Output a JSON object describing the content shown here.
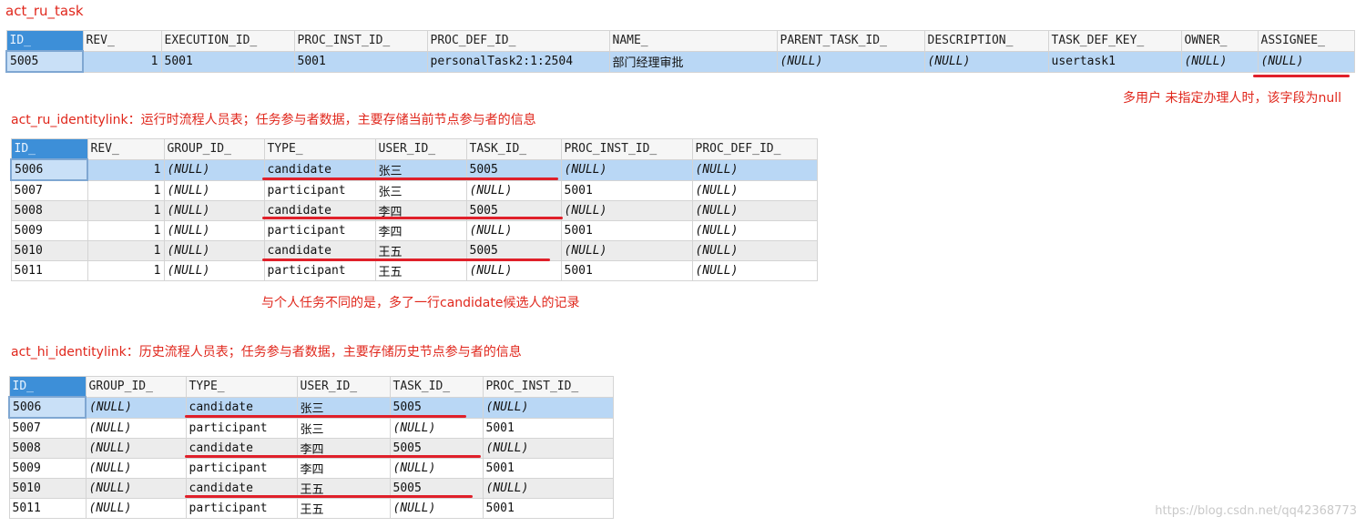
{
  "section1": {
    "title": "act_ru_task",
    "columns": [
      "ID_",
      "REV_",
      "EXECUTION_ID_",
      "PROC_INST_ID_",
      "PROC_DEF_ID_",
      "NAME_",
      "PARENT_TASK_ID_",
      "DESCRIPTION_",
      "TASK_DEF_KEY_",
      "OWNER_",
      "ASSIGNEE_"
    ],
    "rows": [
      [
        "5005",
        "1",
        "5001",
        "5001",
        "personalTask2:1:2504",
        "部门经理审批",
        "(NULL)",
        "(NULL)",
        "usertask1",
        "(NULL)",
        "(NULL)"
      ]
    ],
    "note": "多用户 未指定办理人时，该字段为null"
  },
  "section2": {
    "title": "act_ru_identitylink：运行时流程人员表；任务参与者数据，主要存储当前节点参与者的信息",
    "columns": [
      "ID_",
      "REV_",
      "GROUP_ID_",
      "TYPE_",
      "USER_ID_",
      "TASK_ID_",
      "PROC_INST_ID_",
      "PROC_DEF_ID_"
    ],
    "rows": [
      [
        "5006",
        "1",
        "(NULL)",
        "candidate",
        "张三",
        "5005",
        "(NULL)",
        "(NULL)"
      ],
      [
        "5007",
        "1",
        "(NULL)",
        "participant",
        "张三",
        "(NULL)",
        "5001",
        "(NULL)"
      ],
      [
        "5008",
        "1",
        "(NULL)",
        "candidate",
        "李四",
        "5005",
        "(NULL)",
        "(NULL)"
      ],
      [
        "5009",
        "1",
        "(NULL)",
        "participant",
        "李四",
        "(NULL)",
        "5001",
        "(NULL)"
      ],
      [
        "5010",
        "1",
        "(NULL)",
        "candidate",
        "王五",
        "5005",
        "(NULL)",
        "(NULL)"
      ],
      [
        "5011",
        "1",
        "(NULL)",
        "participant",
        "王五",
        "(NULL)",
        "5001",
        "(NULL)"
      ]
    ],
    "note": "与个人任务不同的是，多了一行candidate候选人的记录"
  },
  "section3": {
    "title": "act_hi_identitylink：历史流程人员表；任务参与者数据，主要存储历史节点参与者的信息",
    "columns": [
      "ID_",
      "GROUP_ID_",
      "TYPE_",
      "USER_ID_",
      "TASK_ID_",
      "PROC_INST_ID_"
    ],
    "rows": [
      [
        "5006",
        "(NULL)",
        "candidate",
        "张三",
        "5005",
        "(NULL)"
      ],
      [
        "5007",
        "(NULL)",
        "participant",
        "张三",
        "(NULL)",
        "5001"
      ],
      [
        "5008",
        "(NULL)",
        "candidate",
        "李四",
        "5005",
        "(NULL)"
      ],
      [
        "5009",
        "(NULL)",
        "participant",
        "李四",
        "(NULL)",
        "5001"
      ],
      [
        "5010",
        "(NULL)",
        "candidate",
        "王五",
        "5005",
        "(NULL)"
      ],
      [
        "5011",
        "(NULL)",
        "participant",
        "王五",
        "(NULL)",
        "5001"
      ]
    ]
  },
  "watermark": "https://blog.csdn.net/qq42368773",
  "colors": {
    "annotation_red": "#e0271c",
    "underline_red": "#e0202a",
    "header_id_blue": "#3d8fd8",
    "selected_row_blue": "#b9d7f5",
    "alt_row_gray": "#ececec"
  }
}
